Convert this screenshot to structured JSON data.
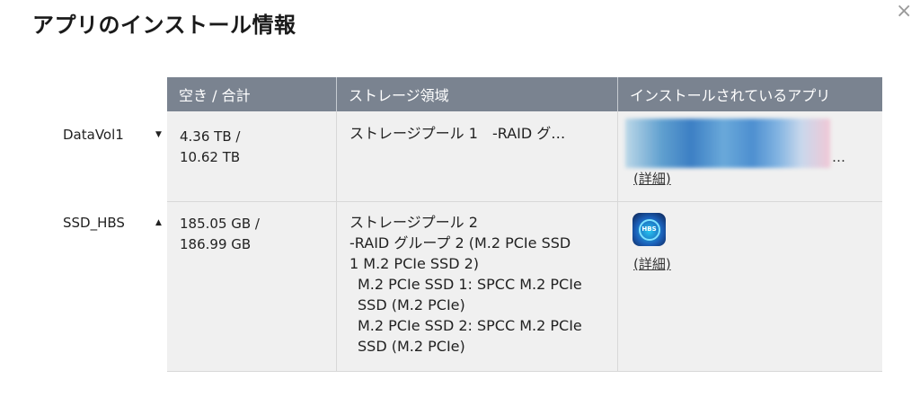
{
  "dialog": {
    "title": "アプリのインストール情報",
    "close_icon": "×"
  },
  "volumes": [
    {
      "name": "DataVol1",
      "arrow": "▼"
    },
    {
      "name": "SSD_HBS",
      "arrow": "▲"
    }
  ],
  "table": {
    "headers": [
      "空き / 合計",
      "ストレージ領域",
      "インストールされているアプリ"
    ],
    "rows": [
      {
        "free": "4.36 TB /",
        "total": "10.62 TB",
        "storage_lines": [
          "ストレージプール 1　-RAID グ…"
        ],
        "apps_more": "…",
        "details": "(詳細)"
      },
      {
        "free": "185.05 GB /",
        "total": "186.99 GB",
        "storage_lines": [
          "ストレージプール 2",
          "-RAID グループ 2 (M.2 PCIe SSD",
          "1 M.2 PCIe SSD 2)",
          "M.2 PCIe SSD 1: SPCC M.2 PCIe",
          "SSD (M.2 PCIe)",
          "M.2 PCIe SSD 2: SPCC M.2 PCIe",
          "SSD (M.2 PCIe)"
        ],
        "app_icon": "hbs-icon",
        "app_icon_text": "HBS",
        "details": "(詳細)"
      }
    ]
  }
}
